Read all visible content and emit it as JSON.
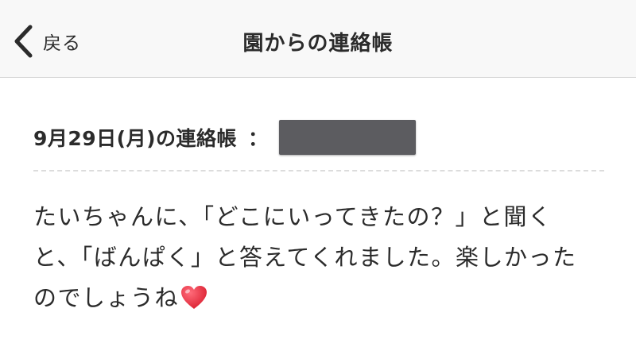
{
  "nav": {
    "back_label": "戻る",
    "title": "園からの連絡帳"
  },
  "entry": {
    "date_label": "9月29日(月)の連絡帳",
    "separator": "：",
    "message_lines": [
      "たいちゃんに、「どこにいってきたの？」と聞く",
      "と、「ばんぱく」と答えてくれました。楽しかった",
      "のでしょうね"
    ]
  },
  "icons": {
    "back": "chevron-left-icon",
    "heart": "red-heart-icon"
  },
  "colors": {
    "nav_background": "#f8f8f8",
    "text": "#2b2b2b",
    "redacted": "#5c5c60",
    "heart": "#e0245e"
  }
}
